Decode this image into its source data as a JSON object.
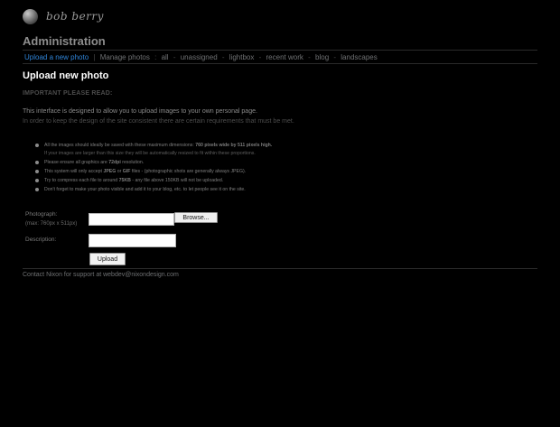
{
  "brand": {
    "name": "bob berry",
    "logo_icon": "sphere-icon"
  },
  "header": {
    "title": "Administration"
  },
  "nav": {
    "active_label": "Upload a new photo",
    "separator_main": "|",
    "manage_label": "Manage photos",
    "separator_colon": ":",
    "items": [
      {
        "label": "all"
      },
      {
        "label": "unassigned"
      },
      {
        "label": "lightbox"
      },
      {
        "label": "recent work"
      },
      {
        "label": "blog"
      },
      {
        "label": "landscapes"
      }
    ],
    "separator_item": "-"
  },
  "page": {
    "title": "Upload new photo",
    "important_label": "IMPORTANT PLEASE READ:",
    "intro_line1": "This interface is designed to allow you to upload images to your own personal page.",
    "intro_line2": "In order to keep the design of the site consistent there are certain requirements that must be met."
  },
  "rules": [
    {
      "text_prefix": "All the images should ideally be saved with these maximum dimensions: ",
      "highlight": "760 pixels wide by 511 pixels high.",
      "subtext": "If your images are larger than this size they will be automatically resized to fit within these proportions."
    },
    {
      "text_prefix": "Please ensure all graphics are ",
      "highlight": "72dpi",
      "text_suffix": " resolution."
    },
    {
      "text_prefix": "This system will only accept ",
      "highlight1": "JPEG",
      "middle": " or ",
      "highlight2": "GIF",
      "text_suffix": " files - (photographic shots are generally always JPEG)."
    },
    {
      "text_prefix": "Try to compress each file to around ",
      "highlight": "75KB",
      "text_suffix": " - any file above 150KB will not be uploaded."
    },
    {
      "text": "Don't forget to make your photo visible and add it to your blog, etc. to let people see it on the site."
    }
  ],
  "form": {
    "photograph_label": "Photograph:",
    "photograph_hint": "(max: 760px x 511px)",
    "photograph_value": "",
    "browse_label": "Browse...",
    "description_label": "Description:",
    "description_value": "",
    "upload_label": "Upload"
  },
  "footer": {
    "text": "Contact Nixon for support at webdev@nixondesign.com"
  },
  "colors": {
    "background": "#000000",
    "accent": "#2f84d8",
    "text": "#8b8b8b"
  }
}
